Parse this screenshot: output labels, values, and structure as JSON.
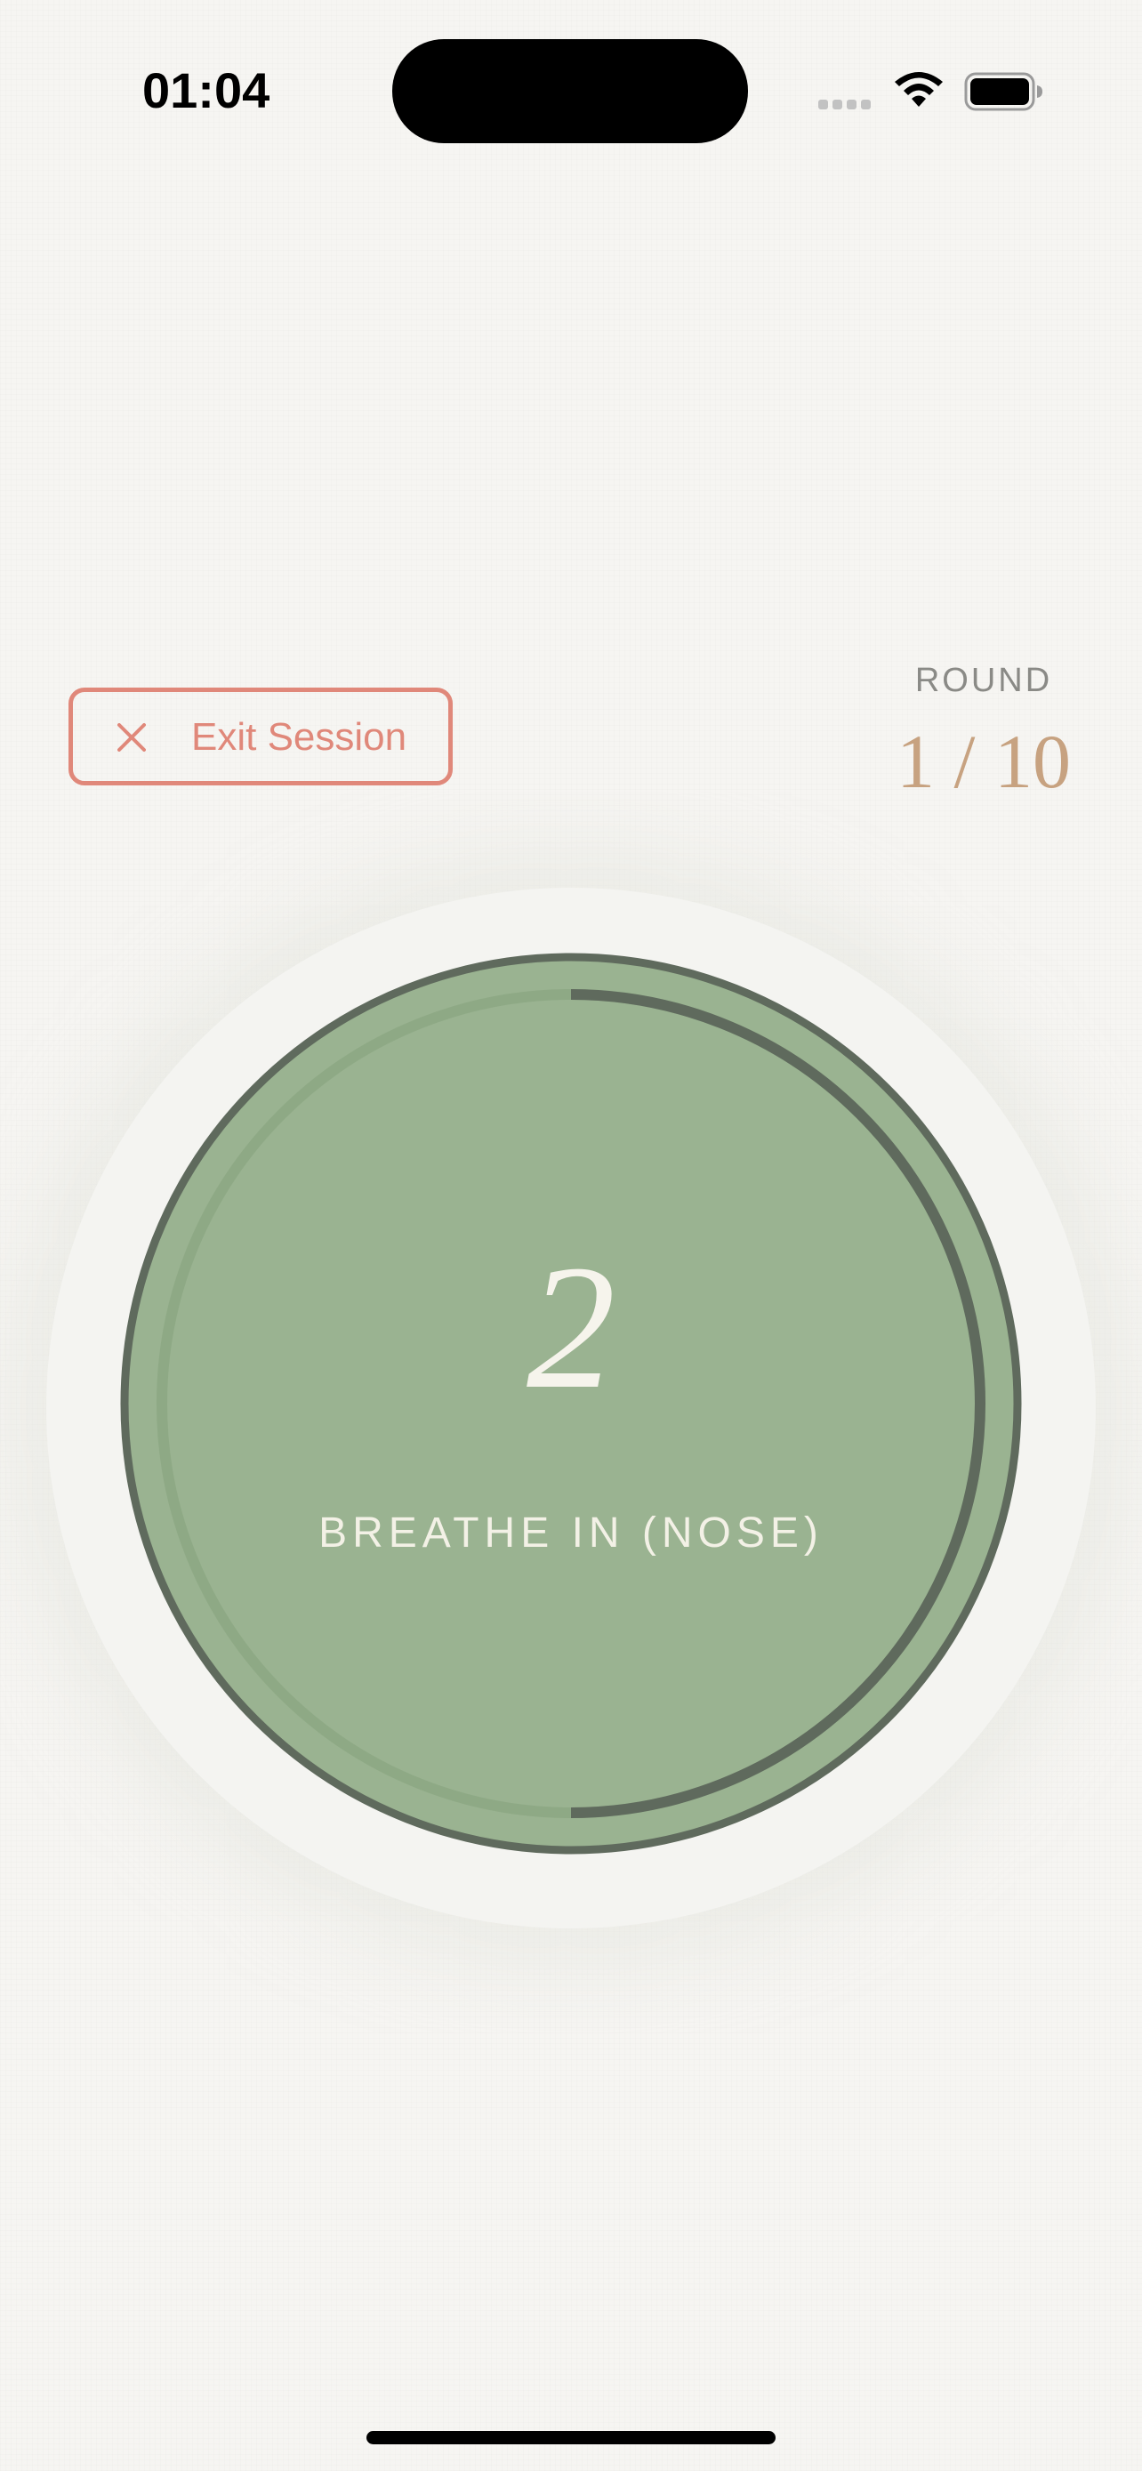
{
  "status_bar": {
    "time": "01:04",
    "signal_icon": "cellular-signal-icon",
    "wifi_icon": "wifi-icon",
    "battery_icon": "battery-icon"
  },
  "session": {
    "exit_label": "Exit Session",
    "exit_icon": "close-icon",
    "round_label": "ROUND",
    "round_value": "1 / 10",
    "round_current": 1,
    "round_total": 10
  },
  "breath": {
    "count": "2",
    "phase": "BREATHE IN (NOSE)",
    "phase_progress": 0.5
  },
  "colors": {
    "background": "#f6f5f2",
    "accent_red": "#e0887a",
    "round_gold": "#c7a280",
    "circle_green": "#9ab391",
    "ring_dark": "#5f6a5d",
    "ring_light": "#8ea985",
    "text_light": "#f6f4ec"
  }
}
